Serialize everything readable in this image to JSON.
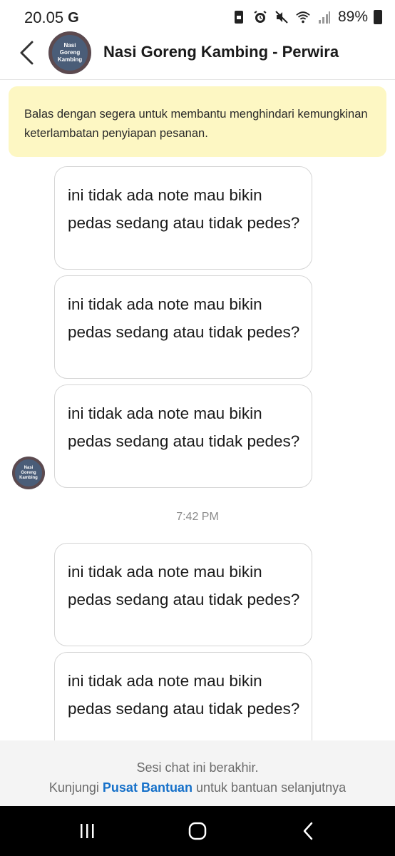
{
  "status_bar": {
    "time": "20.05",
    "carrier_icon": "G",
    "battery": "89%",
    "icons": [
      "screen-lock-icon",
      "alarm-icon",
      "mute-icon",
      "wifi-icon",
      "signal-icon",
      "battery-icon"
    ]
  },
  "header": {
    "title": "Nasi Goreng Kambing - Perwira",
    "avatar_text": "Nasi Goreng Kambing"
  },
  "notice": {
    "text": "Balas dengan segera untuk membantu menghindari kemungkinan keterlambatan penyiapan pesanan."
  },
  "messages": [
    {
      "text": "ini tidak ada note mau bikin pedas sedang atau tidak pedes?"
    },
    {
      "text": "ini tidak ada note mau bikin pedas sedang atau tidak pedes?"
    },
    {
      "text": "ini tidak ada note mau bikin pedas sedang atau tidak pedes?"
    },
    {
      "text": "ini tidak ada note mau bikin pedas sedang atau tidak pedes?"
    },
    {
      "text": "ini tidak ada note mau bikin pedas sedang atau tidak pedes?"
    }
  ],
  "timestamp": "7:42 PM",
  "footer": {
    "line1": "Sesi chat ini berakhir.",
    "line2_before": "Kunjungi",
    "link": "Pusat Bantuan",
    "line2_after": "untuk bantuan selanjutnya"
  },
  "colors": {
    "notice_bg": "#fdf7c3",
    "link": "#1570c9",
    "footer_bg": "#f4f4f4"
  }
}
